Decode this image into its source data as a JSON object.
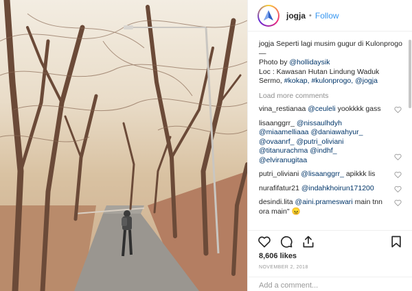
{
  "post": {
    "username": "jogja",
    "follow_label": "Follow",
    "separator": "•",
    "caption_lines": [
      "jogja Seperti lagi musim gugur di Kulonprogo",
      "—"
    ],
    "photo_by_prefix": "Photo by ",
    "photo_by_handle": "@hollidaysik",
    "loc_text": "Loc : Kawasan Hutan Lindung Waduk Sermo, ",
    "loc_tags": "#kokap, #kulonprogo, @jogja",
    "load_more": "Load more comments"
  },
  "comments": [
    {
      "user": "vina_restianaa",
      "mention": "@ceuleli",
      "text": " yookkkk gass"
    },
    {
      "user": "lisaanggrr_",
      "mention": "@nissaulhdyh @miaamelliaaa @daniawahyur_ @ovaanrf_ @putri_oliviani @titanurachma @indhf_ @elviranugitaa",
      "text": ""
    },
    {
      "user": "putri_oliviani",
      "mention": "@lisaanggrr_",
      "text": " apikkk lis"
    },
    {
      "user": "nurafifatur21",
      "mention": "@indahkhoirun171200",
      "text": ""
    },
    {
      "user": "desindi.lita",
      "mention": "@aini.prameswari",
      "text": " main tnn ora main\" 😠"
    }
  ],
  "stats": {
    "likes": "8,606 likes",
    "date": "NOVEMBER 2, 2018"
  },
  "composer": {
    "placeholder": "Add a comment..."
  },
  "icons": {
    "like": "heart-icon",
    "comment": "comment-icon",
    "share": "share-icon",
    "save": "bookmark-icon"
  }
}
